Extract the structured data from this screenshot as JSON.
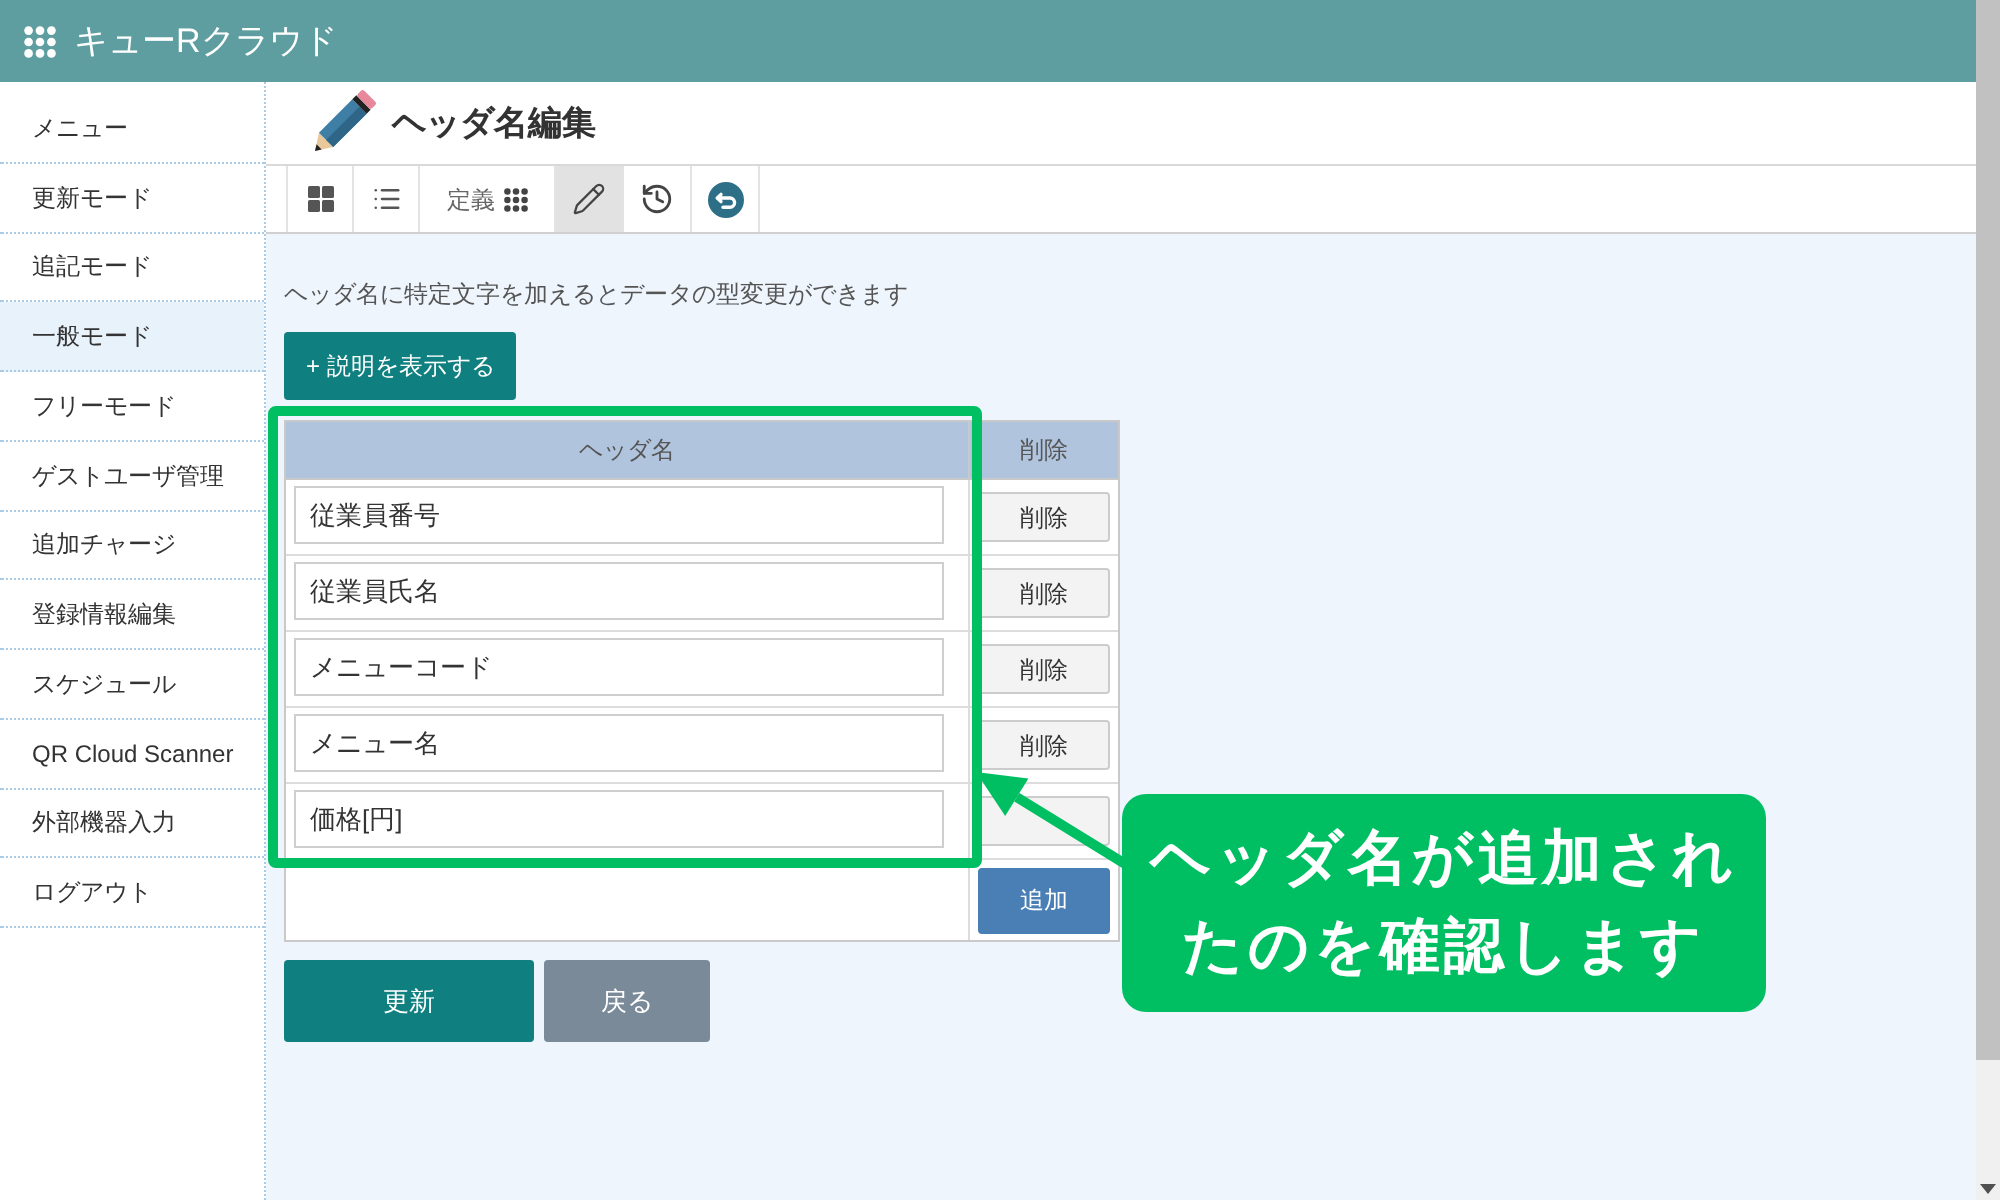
{
  "app": {
    "title": "キューRクラウド"
  },
  "sidebar": {
    "items": [
      {
        "label": "メニュー",
        "selected": false
      },
      {
        "label": "更新モード",
        "selected": false
      },
      {
        "label": "追記モード",
        "selected": false
      },
      {
        "label": "一般モード",
        "selected": true
      },
      {
        "label": "フリーモード",
        "selected": false
      },
      {
        "label": "ゲストユーザ管理",
        "selected": false
      },
      {
        "label": "追加チャージ",
        "selected": false
      },
      {
        "label": "登録情報編集",
        "selected": false
      },
      {
        "label": "スケジュール",
        "selected": false
      },
      {
        "label": "QR Cloud Scanner",
        "selected": false
      },
      {
        "label": "外部機器入力",
        "selected": false
      },
      {
        "label": "ログアウト",
        "selected": false
      }
    ]
  },
  "page": {
    "title": "ヘッダ名編集"
  },
  "toolbar": {
    "items": [
      {
        "kind": "grid",
        "selected": false
      },
      {
        "kind": "list",
        "selected": false
      },
      {
        "kind": "define",
        "label": "定義",
        "selected": false
      },
      {
        "kind": "edit",
        "selected": true
      },
      {
        "kind": "history",
        "selected": false
      },
      {
        "kind": "back",
        "selected": false
      }
    ]
  },
  "notice": "ヘッダ名に特定文字を加えるとデータの型変更ができます",
  "help_button": {
    "label": "+ 説明を表示する"
  },
  "table": {
    "columns": [
      "ヘッダ名",
      "削除"
    ],
    "rows": [
      {
        "header_name": "従業員番号",
        "delete_button": "削除"
      },
      {
        "header_name": "従業員氏名",
        "delete_button": "削除"
      },
      {
        "header_name": "メニューコード",
        "delete_button": "削除"
      },
      {
        "header_name": "メニュー名",
        "delete_button": "削除"
      },
      {
        "header_name": "価格[円]"
      }
    ],
    "add_button": "追加"
  },
  "actions": [
    {
      "kind": "primary",
      "label": "更新"
    },
    {
      "kind": "secondary",
      "label": "戻る"
    }
  ],
  "callout": {
    "text": "ヘッダ名が追加されたのを確認します"
  }
}
